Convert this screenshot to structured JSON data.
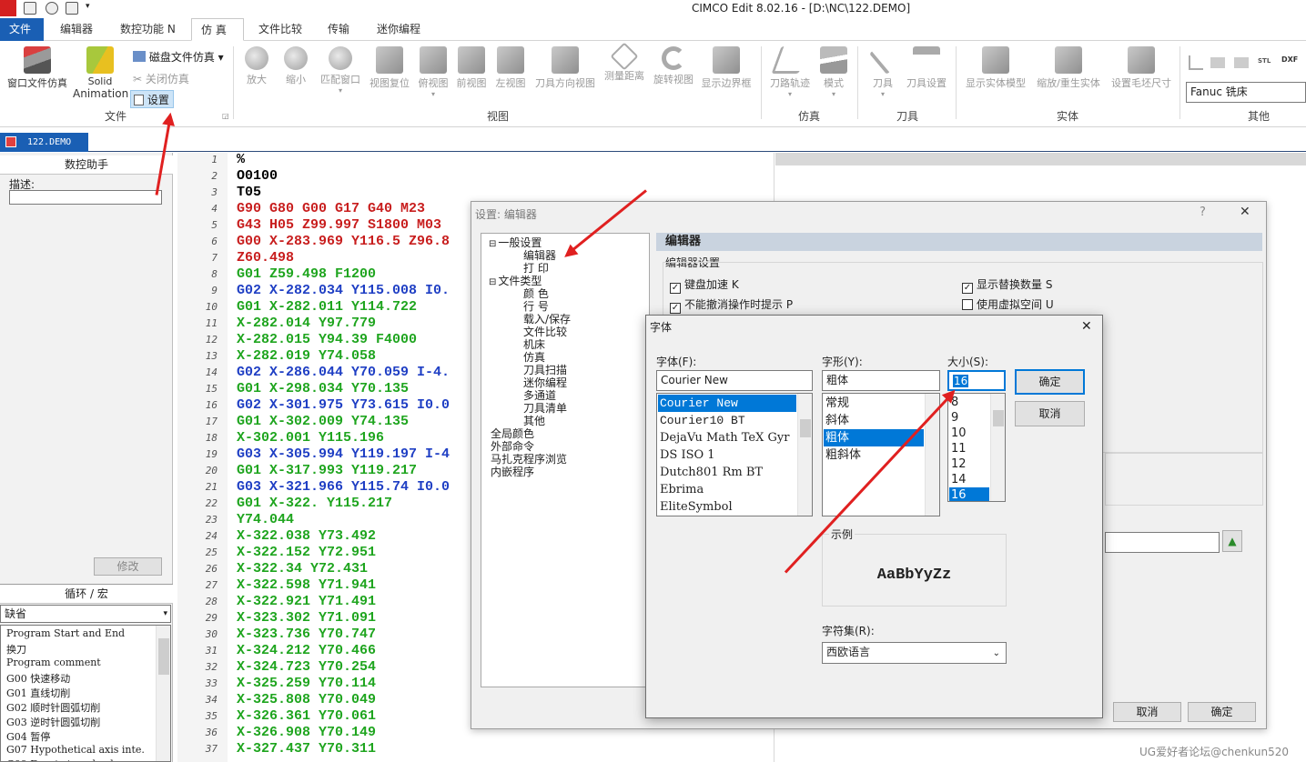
{
  "app": {
    "title": "CIMCO Edit 8.02.16 - [D:\\NC\\122.DEMO]"
  },
  "menu_tabs": [
    "文件 F",
    "编辑器",
    "数控功能 N",
    "仿 真",
    "文件比较",
    "传输",
    "迷你编程"
  ],
  "ribbon": {
    "file_group": {
      "window_sim": "窗口文件仿真",
      "solid_anim_line1": "Solid",
      "solid_anim_line2": "Animation",
      "disk_sim": "磁盘文件仿真",
      "close_sim": "关闭仿真",
      "settings": "设置",
      "label": "文件"
    },
    "view_group": {
      "buttons": [
        "放大",
        "缩小",
        "匹配窗口",
        "视图复位",
        "俯视图",
        "前视图",
        "左视图",
        "刀具方向视图",
        "测量距离",
        "旋转视图",
        "显示边界框"
      ],
      "label": "视图"
    },
    "sim_group": {
      "buttons": [
        "刀路轨迹",
        "模式"
      ],
      "label": "仿真"
    },
    "tool_group": {
      "buttons": [
        "刀具",
        "刀具设置"
      ],
      "label": "刀具"
    },
    "solid_group": {
      "buttons": [
        "显示实体模型",
        "缩放/重生实体",
        "设置毛坯尺寸"
      ],
      "label": "实体"
    },
    "other_group": {
      "machine": "Fanuc 铣床",
      "label": "其他",
      "dxf": "DXF",
      "stl": "STL"
    }
  },
  "doc_tab": "122.DEMO",
  "left_panel": {
    "assistant_title": "数控助手",
    "desc_label": "描述:",
    "modify_button": "修改",
    "cycle_title": "循环 / 宏",
    "cycle_select": "缺省",
    "items": [
      "Program Start and End",
      "换刀",
      "Program comment",
      "G00 快速移动",
      "G01 直线切削",
      "G02 顺时针圆弧切削",
      "G03 逆时针圆弧切削",
      "G04 暂停",
      "G07 Hypothetical axis inte.",
      "G09 Exact stop check"
    ]
  },
  "editor": {
    "line_numbers": [
      "1",
      "2",
      "3",
      "4",
      "5",
      "6",
      "7",
      "8",
      "9",
      "10",
      "11",
      "12",
      "13",
      "14",
      "15",
      "16",
      "17",
      "18",
      "19",
      "20",
      "21",
      "22",
      "23",
      "24",
      "25",
      "26",
      "27",
      "28",
      "29",
      "30",
      "31",
      "32",
      "33",
      "34",
      "35",
      "36",
      "37"
    ],
    "lines": [
      {
        "t": "%",
        "c": "#000000"
      },
      {
        "t": "O0100",
        "c": "#000000"
      },
      {
        "t": "T05",
        "c": "#000000"
      },
      {
        "t": "G90 G80 G00 G17 G40 M23",
        "c": "#c81e1e"
      },
      {
        "t": "G43 H05 Z99.997 S1800 M03",
        "c": "#c81e1e"
      },
      {
        "t": "G00 X-283.969 Y116.5 Z96.8",
        "c": "#c81e1e"
      },
      {
        "t": "Z60.498",
        "c": "#c81e1e"
      },
      {
        "t": "G01 Z59.498 F1200",
        "c": "#1fa51f"
      },
      {
        "t": "G02 X-282.034 Y115.008 I0.",
        "c": "#1f3fc4"
      },
      {
        "t": "G01 X-282.011 Y114.722",
        "c": "#1fa51f"
      },
      {
        "t": "X-282.014 Y97.779",
        "c": "#1fa51f"
      },
      {
        "t": "X-282.015 Y94.39 F4000",
        "c": "#1fa51f"
      },
      {
        "t": "X-282.019 Y74.058",
        "c": "#1fa51f"
      },
      {
        "t": "G02 X-286.044 Y70.059 I-4.",
        "c": "#1f3fc4"
      },
      {
        "t": "G01 X-298.034 Y70.135",
        "c": "#1fa51f"
      },
      {
        "t": "G02 X-301.975 Y73.615 I0.0",
        "c": "#1f3fc4"
      },
      {
        "t": "G01 X-302.009 Y74.135",
        "c": "#1fa51f"
      },
      {
        "t": "X-302.001 Y115.196",
        "c": "#1fa51f"
      },
      {
        "t": "G03 X-305.994 Y119.197 I-4",
        "c": "#1f3fc4"
      },
      {
        "t": "G01 X-317.993 Y119.217",
        "c": "#1fa51f"
      },
      {
        "t": "G03 X-321.966 Y115.74 I0.0",
        "c": "#1f3fc4"
      },
      {
        "t": "G01 X-322. Y115.217",
        "c": "#1fa51f"
      },
      {
        "t": "Y74.044",
        "c": "#1fa51f"
      },
      {
        "t": "X-322.038 Y73.492",
        "c": "#1fa51f"
      },
      {
        "t": "X-322.152 Y72.951",
        "c": "#1fa51f"
      },
      {
        "t": "X-322.34 Y72.431",
        "c": "#1fa51f"
      },
      {
        "t": "X-322.598 Y71.941",
        "c": "#1fa51f"
      },
      {
        "t": "X-322.921 Y71.491",
        "c": "#1fa51f"
      },
      {
        "t": "X-323.302 Y71.091",
        "c": "#1fa51f"
      },
      {
        "t": "X-323.736 Y70.747",
        "c": "#1fa51f"
      },
      {
        "t": "X-324.212 Y70.466",
        "c": "#1fa51f"
      },
      {
        "t": "X-324.723 Y70.254",
        "c": "#1fa51f"
      },
      {
        "t": "X-325.259 Y70.114",
        "c": "#1fa51f"
      },
      {
        "t": "X-325.808 Y70.049",
        "c": "#1fa51f"
      },
      {
        "t": "X-326.361 Y70.061",
        "c": "#1fa51f"
      },
      {
        "t": "X-326.908 Y70.149",
        "c": "#1fa51f"
      },
      {
        "t": "X-327.437 Y70.311",
        "c": "#1fa51f"
      }
    ]
  },
  "settings_dialog": {
    "title": "设置: 编辑器",
    "help": "?",
    "close": "✕",
    "tree": [
      {
        "label": "一般设置",
        "level": 0,
        "exp": "⊟"
      },
      {
        "label": "编辑器",
        "level": 1,
        "exp": ""
      },
      {
        "label": "打  印",
        "level": 1,
        "exp": ""
      },
      {
        "label": "文件类型",
        "level": 0,
        "exp": "⊟"
      },
      {
        "label": "颜  色",
        "level": 1,
        "exp": ""
      },
      {
        "label": "行  号",
        "level": 1,
        "exp": ""
      },
      {
        "label": "载入/保存",
        "level": 1,
        "exp": ""
      },
      {
        "label": "文件比较",
        "level": 1,
        "exp": ""
      },
      {
        "label": "机床",
        "level": 1,
        "exp": ""
      },
      {
        "label": "仿真",
        "level": 1,
        "exp": ""
      },
      {
        "label": "刀具扫描",
        "level": 1,
        "exp": ""
      },
      {
        "label": "迷你编程",
        "level": 1,
        "exp": ""
      },
      {
        "label": "多通道",
        "level": 1,
        "exp": ""
      },
      {
        "label": "刀具清单",
        "level": 1,
        "exp": ""
      },
      {
        "label": "其他",
        "level": 1,
        "exp": ""
      },
      {
        "label": "全局颜色",
        "level": 0,
        "exp": ""
      },
      {
        "label": "外部命令",
        "level": 0,
        "exp": ""
      },
      {
        "label": "马扎克程序浏览",
        "level": 0,
        "exp": ""
      },
      {
        "label": "内嵌程序",
        "level": 0,
        "exp": ""
      }
    ],
    "section_title": "编辑器",
    "subsection": "编辑器设置",
    "opt1": "键盘加速 K",
    "opt2": "不能撤消操作时提示 P",
    "opt3": "显示替换数量 S",
    "opt4": "使用虚拟空间 U",
    "cancel": "取消",
    "ok": "确定"
  },
  "font_dialog": {
    "title": "字体",
    "close": "✕",
    "font_label": "字体(F):",
    "font_value": "Courier New",
    "fonts": [
      "Courier New",
      "Courier10 BT",
      "DejaVu Math TeX Gyr",
      "DS ISO 1",
      "Dutch801 Rm BT",
      "Ebrima",
      "EliteSymbol"
    ],
    "style_label": "字形(Y):",
    "style_value": "粗体",
    "styles": [
      "常规",
      "斜体",
      "粗体",
      "粗斜体"
    ],
    "size_label": "大小(S):",
    "size_value": "16",
    "sizes": [
      "8",
      "9",
      "10",
      "11",
      "12",
      "14",
      "16"
    ],
    "ok": "确定",
    "cancel": "取消",
    "sample_label": "示例",
    "sample_text": "AaBbYyZz",
    "charset_label": "字符集(R):",
    "charset_value": "西欧语言"
  },
  "watermark": "UG爱好者论坛@chenkun520"
}
